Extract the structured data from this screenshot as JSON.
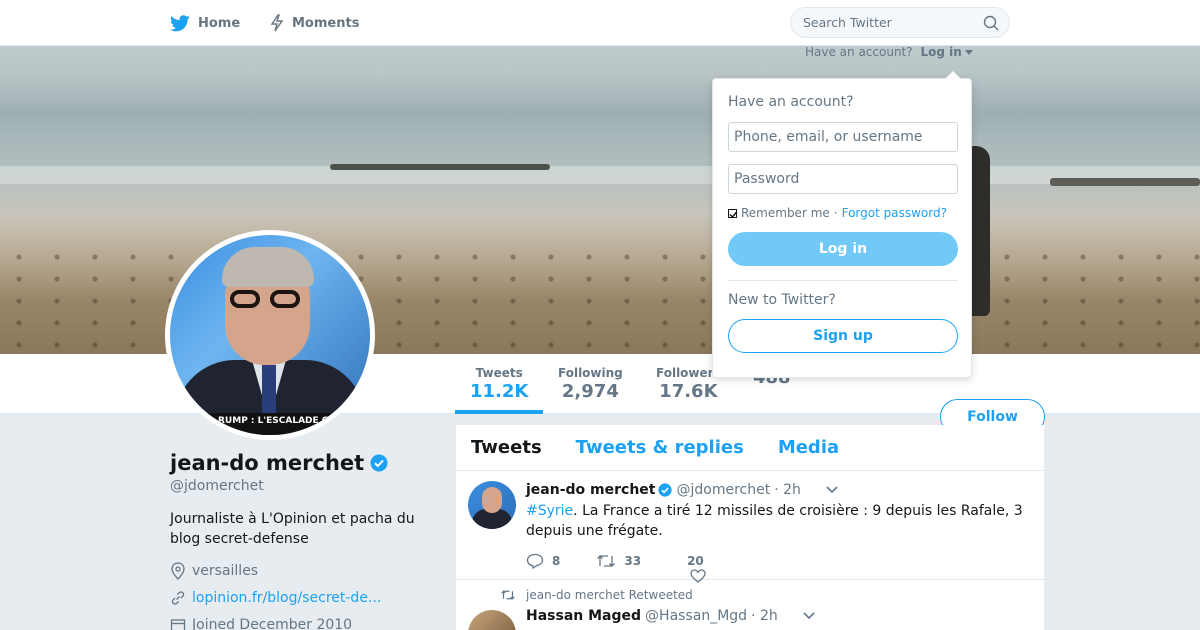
{
  "nav": {
    "home_label": "Home",
    "moments_label": "Moments",
    "search_placeholder": "Search Twitter",
    "have_account": "Have an account?",
    "login_label": "Log in"
  },
  "profile": {
    "name": "jean-do merchet",
    "handle": "@jdomerchet",
    "bio": "Journaliste à L'Opinion et pacha du blog secret-defense",
    "location": "versailles",
    "website": "lopinion.fr/blog/secret-de...",
    "joined": "Joined December 2010",
    "avatar_caption": "RUMP : L'ESCALADE GUE"
  },
  "stats": [
    {
      "label": "Tweets",
      "value": "11.2K"
    },
    {
      "label": "Following",
      "value": "2,974"
    },
    {
      "label": "Followers",
      "value": "17.6K"
    },
    {
      "label": "",
      "value": "488"
    }
  ],
  "follow_label": "Follow",
  "timeline": {
    "tabs": [
      "Tweets",
      "Tweets & replies",
      "Media"
    ],
    "tweets": [
      {
        "author": "jean-do merchet",
        "handle": "@jdomerchet",
        "time": "· 2h",
        "hashtag": "#Syrie",
        "text": ". La France a tiré 12 missiles de croisière : 9 depuis les Rafale, 3 depuis une frégate.",
        "replies": "8",
        "retweets": "33",
        "likes": "20"
      }
    ],
    "retweet_note": "jean-do merchet Retweeted",
    "tweet2": {
      "author": "Hassan Maged",
      "handle": "@Hassan_Mgd",
      "time": "· 2h"
    }
  },
  "login_dropdown": {
    "title": "Have an account?",
    "username_placeholder": "Phone, email, or username",
    "password_placeholder": "Password",
    "remember": "Remember me",
    "separator": "·",
    "forgot": "Forgot password?",
    "login_button": "Log in",
    "new_to": "New to Twitter?",
    "signup_button": "Sign up"
  },
  "colors": {
    "accent": "#1da1f2",
    "text": "#14171a",
    "muted": "#657786",
    "background": "#e6ecf0"
  }
}
